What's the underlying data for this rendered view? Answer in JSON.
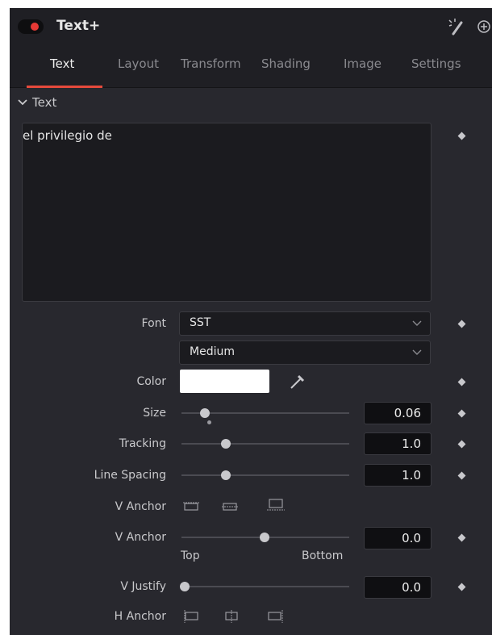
{
  "header": {
    "title": "Text+"
  },
  "tabs": [
    "Text",
    "Layout",
    "Transform",
    "Shading",
    "Image",
    "Settings"
  ],
  "active_tab": "Text",
  "section": {
    "title": "Text"
  },
  "text_input": {
    "value": "el privilegio de"
  },
  "font": {
    "label": "Font",
    "value": "SST",
    "style_value": "Medium"
  },
  "color": {
    "label": "Color",
    "value": "#ffffff"
  },
  "size": {
    "label": "Size",
    "value": "0.06"
  },
  "tracking": {
    "label": "Tracking",
    "value": "1.0"
  },
  "line_spacing": {
    "label": "Line Spacing",
    "value": "1.0"
  },
  "v_anchor_buttons": {
    "label": "V Anchor"
  },
  "v_anchor_slider": {
    "label": "V Anchor",
    "value": "0.0",
    "min_label": "Top",
    "max_label": "Bottom"
  },
  "v_justify": {
    "label": "V Justify",
    "value": "0.0"
  },
  "h_anchor": {
    "label": "H Anchor"
  },
  "icons": {
    "toggle": "toggle-switch",
    "magic": "magic-wand-icon",
    "reset": "reset-icon",
    "collapse": "chevron-down-icon",
    "keyframe": "keyframe-diamond-icon",
    "eyedropper": "eyedropper-icon"
  },
  "colors": {
    "accent": "#e64a3c",
    "panel": "#28282e",
    "header": "#1f1f24"
  }
}
